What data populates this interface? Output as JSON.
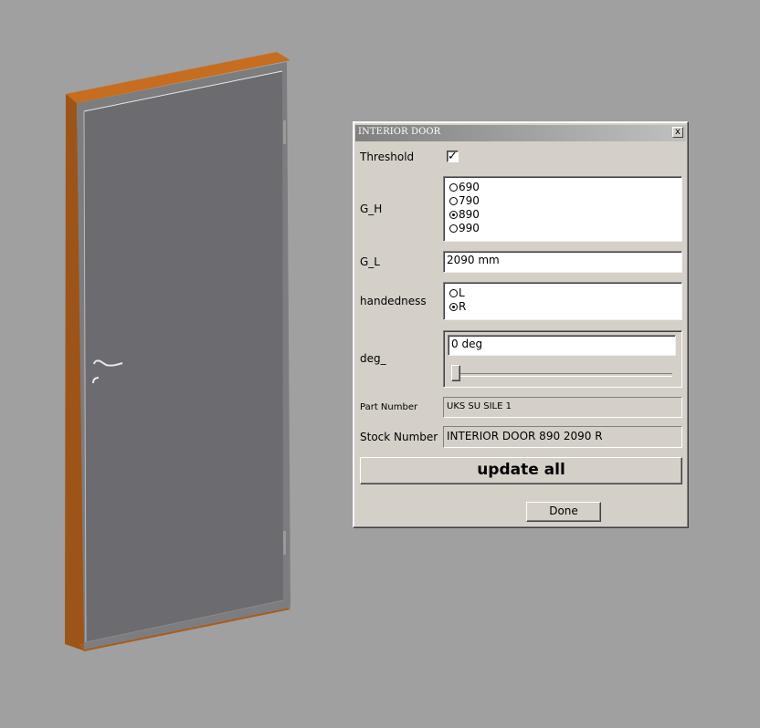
{
  "dialog": {
    "title": "INTERIOR DOOR",
    "close_label": "x",
    "threshold": {
      "label": "Threshold",
      "checked": true,
      "mark": "✓"
    },
    "g_h": {
      "label": "G_H",
      "options": [
        "690",
        "790",
        "890",
        "990"
      ],
      "selected": "890"
    },
    "g_l": {
      "label": "G_L",
      "value": "2090 mm"
    },
    "handedness": {
      "label": "handedness",
      "options": [
        "L",
        "R"
      ],
      "selected": "R"
    },
    "deg": {
      "label": "deg_",
      "value": "0 deg"
    },
    "part_number": {
      "label": "Part Number",
      "value": "UKS SU SILE 1"
    },
    "stock_number": {
      "label": "Stock Number",
      "value": "INTERIOR DOOR 890 2090 R"
    },
    "update_label": "update all",
    "done_label": "Done"
  },
  "colors": {
    "background": "#a0a0a0",
    "door_panel": "#6b6b70",
    "door_frame_wood": "#a0561c",
    "dialog_face": "#d4d0c8"
  }
}
